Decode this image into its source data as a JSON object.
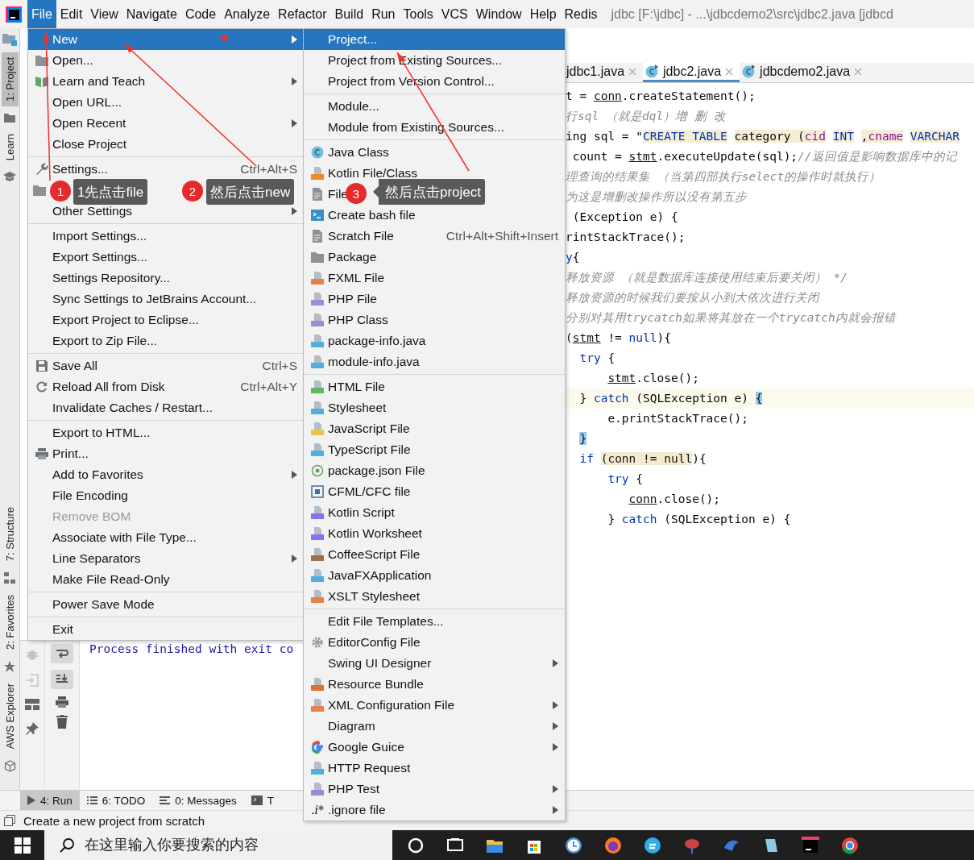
{
  "menu_bar": {
    "items": [
      {
        "label": "File",
        "selected": true
      },
      {
        "label": "Edit",
        "selected": false
      },
      {
        "label": "View",
        "selected": false
      },
      {
        "label": "Navigate",
        "selected": false
      },
      {
        "label": "Code",
        "selected": false
      },
      {
        "label": "Analyze",
        "selected": false
      },
      {
        "label": "Refactor",
        "selected": false
      },
      {
        "label": "Build",
        "selected": false
      },
      {
        "label": "Run",
        "selected": false
      },
      {
        "label": "Tools",
        "selected": false
      },
      {
        "label": "VCS",
        "selected": false
      },
      {
        "label": "Window",
        "selected": false
      },
      {
        "label": "Help",
        "selected": false
      },
      {
        "label": "Redis",
        "selected": false
      }
    ],
    "title": "jdbc [F:\\jdbc] - ...\\jdbcdemo2\\src\\jdbc2.java [jdbcd"
  },
  "tool_strip": [
    {
      "label": "1: Project",
      "selected": true
    },
    {
      "label": "Learn",
      "selected": false
    },
    {
      "label": "7: Structure",
      "selected": false
    },
    {
      "label": "2: Favorites",
      "selected": false
    },
    {
      "label": "AWS Explorer",
      "selected": false
    }
  ],
  "editor_tabs": [
    {
      "label": "jdbc1.java",
      "selected": false
    },
    {
      "label": "jdbc2.java",
      "selected": true
    },
    {
      "label": "jdbcdemo2.java",
      "selected": false
    }
  ],
  "code_lines": [
    {
      "highlighted": false,
      "segments": [
        {
          "kind": "code",
          "text": "t = "
        },
        {
          "kind": "var",
          "text": "conn"
        },
        {
          "kind": "code",
          "text": ".createStatement();"
        }
      ]
    },
    {
      "highlighted": false,
      "segments": [
        {
          "kind": "comment",
          "text": "行sql （就是dql）增 删 改"
        }
      ]
    },
    {
      "highlighted": false,
      "segments": [
        {
          "kind": "code",
          "text": "ing sql = \""
        },
        {
          "kind": "sql-keyword",
          "text": "CREATE TABLE"
        },
        {
          "kind": "sql",
          "text": " category ("
        },
        {
          "kind": "sql-column",
          "text": "cid"
        },
        {
          "kind": "sql-keyword",
          "text": " INT"
        },
        {
          "kind": "sql",
          "text": " ,"
        },
        {
          "kind": "sql-column",
          "text": "cname"
        },
        {
          "kind": "sql-keyword",
          "text": " VARCHAR"
        }
      ]
    },
    {
      "highlighted": false,
      "segments": [
        {
          "kind": "code",
          "text": " count = "
        },
        {
          "kind": "var",
          "text": "stmt"
        },
        {
          "kind": "code",
          "text": ".executeUpdate(sql);"
        },
        {
          "kind": "comment",
          "text": "//返回值是影响数据库中的记"
        }
      ]
    },
    {
      "highlighted": false,
      "segments": [
        {
          "kind": "comment",
          "text": "理查询的结果集 （当第四部执行select的操作时就执行）"
        }
      ]
    },
    {
      "highlighted": false,
      "segments": [
        {
          "kind": "comment",
          "text": "为这是增删改操作所以没有第五步"
        }
      ]
    },
    {
      "highlighted": false,
      "segments": [
        {
          "kind": "code",
          "text": " (Exception e) {"
        }
      ]
    },
    {
      "highlighted": false,
      "segments": [
        {
          "kind": "code",
          "text": "rintStackTrace();"
        }
      ]
    },
    {
      "highlighted": false,
      "segments": [
        {
          "kind": "keyword",
          "text": "y"
        },
        {
          "kind": "code",
          "text": "{"
        }
      ]
    },
    {
      "highlighted": false,
      "segments": [
        {
          "kind": "comment",
          "text": "释放资源 （就是数据库连接使用结束后要关闭） */"
        }
      ]
    },
    {
      "highlighted": false,
      "segments": [
        {
          "kind": "comment",
          "text": "释放资源的时候我们要按从小到大依次进行关闭"
        }
      ]
    },
    {
      "highlighted": false,
      "segments": [
        {
          "kind": "comment",
          "text": "分别对其用trycatch如果将其放在一个trycatch内就会报错"
        }
      ]
    },
    {
      "highlighted": false,
      "segments": [
        {
          "kind": "code",
          "text": "("
        },
        {
          "kind": "var",
          "text": "stmt"
        },
        {
          "kind": "code",
          "text": " != "
        },
        {
          "kind": "keyword",
          "text": "null"
        },
        {
          "kind": "code",
          "text": "){"
        }
      ]
    },
    {
      "highlighted": false,
      "segments": [
        {
          "kind": "keyword",
          "text": "  try"
        },
        {
          "kind": "code",
          "text": " {"
        }
      ]
    },
    {
      "highlighted": false,
      "segments": [
        {
          "kind": "var",
          "text": "      stmt"
        },
        {
          "kind": "code",
          "text": ".close();"
        }
      ]
    },
    {
      "highlighted": true,
      "segments": [
        {
          "kind": "code",
          "text": "  } "
        },
        {
          "kind": "keyword",
          "text": "catch"
        },
        {
          "kind": "code",
          "text": " (SQLException e) "
        },
        {
          "kind": "brace-match",
          "text": "{"
        }
      ]
    },
    {
      "highlighted": false,
      "segments": [
        {
          "kind": "code",
          "text": "      e.printStackTrace();"
        }
      ]
    },
    {
      "highlighted": false,
      "segments": [
        {
          "kind": "brace-match",
          "text": "  }"
        }
      ]
    },
    {
      "highlighted": false,
      "segments": [
        {
          "kind": "keyword",
          "text": "  if"
        },
        {
          "kind": "match-highlight",
          "text": " (conn != null"
        },
        {
          "kind": "code",
          "text": "){"
        }
      ]
    },
    {
      "highlighted": false,
      "segments": [
        {
          "kind": "keyword",
          "text": "      try"
        },
        {
          "kind": "code",
          "text": " {"
        }
      ]
    },
    {
      "highlighted": false,
      "segments": [
        {
          "kind": "var",
          "text": "         conn"
        },
        {
          "kind": "code",
          "text": ".close();"
        }
      ]
    },
    {
      "highlighted": false,
      "segments": [
        {
          "kind": "code",
          "text": "      } "
        },
        {
          "kind": "keyword",
          "text": "catch"
        },
        {
          "kind": "code",
          "text": " (SQLException e) {"
        }
      ]
    }
  ],
  "run_console": {
    "output": "Process finished with exit co"
  },
  "file_menu": {
    "groups": [
      [
        {
          "label": "New",
          "selected": true,
          "disabled": false,
          "submenu": true
        },
        {
          "label": "Open...",
          "selected": false,
          "disabled": false,
          "submenu": false
        },
        {
          "label": "Learn and Teach",
          "selected": false,
          "disabled": false,
          "submenu": true
        },
        {
          "label": "Open URL...",
          "selected": false,
          "disabled": false,
          "submenu": false
        },
        {
          "label": "Open Recent",
          "selected": false,
          "disabled": false,
          "submenu": true
        },
        {
          "label": "Close Project",
          "selected": false,
          "disabled": false,
          "submenu": false
        }
      ],
      [
        {
          "label": "Settings...",
          "shortcut": "Ctrl+Alt+S",
          "selected": false,
          "disabled": false,
          "submenu": false
        },
        {
          "selected": false
        },
        {
          "label": "Other Settings",
          "selected": false,
          "disabled": false,
          "submenu": true
        }
      ],
      [
        {
          "label": "Import Settings...",
          "selected": false,
          "disabled": false,
          "submenu": false
        },
        {
          "label": "Export Settings...",
          "selected": false,
          "disabled": false,
          "submenu": false
        },
        {
          "label": "Settings Repository...",
          "selected": false,
          "disabled": false,
          "submenu": false
        },
        {
          "label": "Sync Settings to JetBrains Account...",
          "selected": false,
          "disabled": false,
          "submenu": false
        },
        {
          "label": "Export Project to Eclipse...",
          "selected": false,
          "disabled": false,
          "submenu": false
        },
        {
          "label": "Export to Zip File...",
          "selected": false,
          "disabled": false,
          "submenu": false
        }
      ],
      [
        {
          "label": "Save All",
          "shortcut": "Ctrl+S",
          "selected": false,
          "disabled": false,
          "submenu": false
        },
        {
          "label": "Reload All from Disk",
          "shortcut": "Ctrl+Alt+Y",
          "selected": false,
          "disabled": false,
          "submenu": false
        },
        {
          "label": "Invalidate Caches / Restart...",
          "selected": false,
          "disabled": false,
          "submenu": false
        }
      ],
      [
        {
          "label": "Export to HTML...",
          "selected": false,
          "disabled": false,
          "submenu": false
        },
        {
          "label": "Print...",
          "selected": false,
          "disabled": false,
          "submenu": false
        },
        {
          "label": "Add to Favorites",
          "selected": false,
          "disabled": false,
          "submenu": true
        },
        {
          "label": "File Encoding",
          "selected": false,
          "disabled": false,
          "submenu": false
        },
        {
          "label": "Remove BOM",
          "selected": false,
          "disabled": true,
          "submenu": false
        },
        {
          "label": "Associate with File Type...",
          "selected": false,
          "disabled": false,
          "submenu": false
        },
        {
          "label": "Line Separators",
          "selected": false,
          "disabled": false,
          "submenu": true
        },
        {
          "label": "Make File Read-Only",
          "selected": false,
          "disabled": false,
          "submenu": false
        }
      ],
      [
        {
          "label": "Power Save Mode",
          "selected": false,
          "disabled": false,
          "submenu": false
        }
      ],
      [
        {
          "label": "Exit",
          "selected": false,
          "disabled": false,
          "submenu": false
        }
      ]
    ]
  },
  "new_menu": {
    "groups": [
      [
        {
          "label": "Project...",
          "selected": true,
          "submenu": false
        },
        {
          "label": "Project from Existing Sources...",
          "selected": false,
          "submenu": false
        },
        {
          "label": "Project from Version Control...",
          "selected": false,
          "submenu": false
        }
      ],
      [
        {
          "label": "Module...",
          "selected": false,
          "submenu": false
        },
        {
          "label": "Module from Existing Sources...",
          "selected": false,
          "submenu": false
        }
      ],
      [
        {
          "label": "Java Class",
          "selected": false,
          "submenu": false
        },
        {
          "label": "Kotlin File/Class",
          "selected": false,
          "submenu": false
        },
        {
          "label": "File",
          "selected": false,
          "submenu": false
        },
        {
          "label": "Create bash file",
          "selected": false,
          "submenu": false
        },
        {
          "label": "Scratch File",
          "shortcut": "Ctrl+Alt+Shift+Insert",
          "selected": false,
          "submenu": false
        },
        {
          "label": "Package",
          "selected": false,
          "submenu": false
        },
        {
          "label": "FXML File",
          "selected": false,
          "submenu": false
        },
        {
          "label": "PHP File",
          "selected": false,
          "submenu": false
        },
        {
          "label": "PHP Class",
          "selected": false,
          "submenu": false
        },
        {
          "label": "package-info.java",
          "selected": false,
          "submenu": false
        },
        {
          "label": "module-info.java",
          "selected": false,
          "submenu": false
        }
      ],
      [
        {
          "label": "HTML File",
          "selected": false,
          "submenu": false
        },
        {
          "label": "Stylesheet",
          "selected": false,
          "submenu": false
        },
        {
          "label": "JavaScript File",
          "selected": false,
          "submenu": false
        },
        {
          "label": "TypeScript File",
          "selected": false,
          "submenu": false
        },
        {
          "label": "package.json File",
          "selected": false,
          "submenu": false
        },
        {
          "label": "CFML/CFC file",
          "selected": false,
          "submenu": false
        },
        {
          "label": "Kotlin Script",
          "selected": false,
          "submenu": false
        },
        {
          "label": "Kotlin Worksheet",
          "selected": false,
          "submenu": false
        },
        {
          "label": "CoffeeScript File",
          "selected": false,
          "submenu": false
        },
        {
          "label": "JavaFXApplication",
          "selected": false,
          "submenu": false
        },
        {
          "label": "XSLT Stylesheet",
          "selected": false,
          "submenu": false
        }
      ],
      [
        {
          "label": "Edit File Templates...",
          "selected": false,
          "submenu": false
        },
        {
          "label": "EditorConfig File",
          "selected": false,
          "submenu": false
        },
        {
          "label": "Swing UI Designer",
          "selected": false,
          "submenu": true
        },
        {
          "label": "Resource Bundle",
          "selected": false,
          "submenu": false
        },
        {
          "label": "XML Configuration File",
          "selected": false,
          "submenu": true
        },
        {
          "label": "Diagram",
          "selected": false,
          "submenu": true
        },
        {
          "label": "Google Guice",
          "selected": false,
          "submenu": true
        },
        {
          "label": "HTTP Request",
          "selected": false,
          "submenu": false
        },
        {
          "label": "PHP Test",
          "selected": false,
          "submenu": true
        },
        {
          "label": ".ignore file",
          "icon_text": ".i*",
          "selected": false,
          "submenu": true
        }
      ]
    ]
  },
  "annotations": [
    {
      "number": "1",
      "text": "1先点击file"
    },
    {
      "number": "2",
      "text": "然后点击new"
    },
    {
      "number": "3",
      "text": "然后点击project"
    }
  ],
  "bottom_tabs": [
    {
      "label": "4: Run",
      "selected": true
    },
    {
      "label": "6: TODO",
      "selected": false
    },
    {
      "label": "0: Messages",
      "selected": false
    },
    {
      "label": "T",
      "selected": false
    }
  ],
  "status_bar": {
    "text": "Create a new project from scratch"
  },
  "taskbar": {
    "search": {
      "placeholder": "在这里输入你要搜索的内容"
    }
  }
}
